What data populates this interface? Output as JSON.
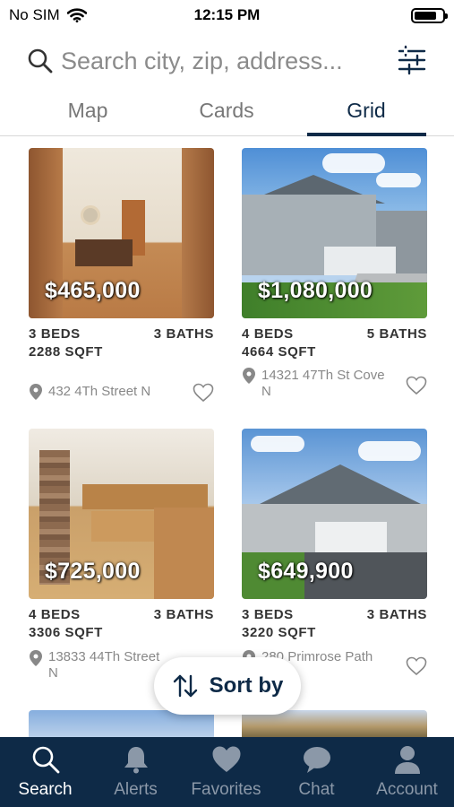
{
  "status_bar": {
    "carrier": "No SIM",
    "time": "12:15 PM"
  },
  "search": {
    "placeholder": "Search city, zip, address..."
  },
  "tabs": [
    {
      "label": "Map",
      "active": false
    },
    {
      "label": "Cards",
      "active": false
    },
    {
      "label": "Grid",
      "active": true
    }
  ],
  "listings": [
    {
      "price": "$465,000",
      "beds": "3 BEDS",
      "baths": "3 BATHS",
      "sqft": "2288 SQFT",
      "address_line1": "432 4Th Street N",
      "address_line2": ""
    },
    {
      "price": "$1,080,000",
      "beds": "4 BEDS",
      "baths": "5 BATHS",
      "sqft": "4664 SQFT",
      "address_line1": "14321 47Th St Cove",
      "address_line2": "N"
    },
    {
      "price": "$725,000",
      "beds": "4 BEDS",
      "baths": "3 BATHS",
      "sqft": "3306 SQFT",
      "address_line1": "13833 44Th Street",
      "address_line2": "N"
    },
    {
      "price": "$649,900",
      "beds": "3 BEDS",
      "baths": "3 BATHS",
      "sqft": "3220 SQFT",
      "address_line1": "280 Primrose Path",
      "address_line2": ""
    }
  ],
  "sort_button": {
    "label": "Sort by"
  },
  "bottom_nav": [
    {
      "label": "Search",
      "icon": "search-icon",
      "active": true
    },
    {
      "label": "Alerts",
      "icon": "bell-icon",
      "active": false
    },
    {
      "label": "Favorites",
      "icon": "heart-icon",
      "active": false
    },
    {
      "label": "Chat",
      "icon": "chat-icon",
      "active": false
    },
    {
      "label": "Account",
      "icon": "person-icon",
      "active": false
    }
  ],
  "colors": {
    "brand_navy": "#0e2a47",
    "inactive_nav": "#8b98a8",
    "muted_text": "#888888"
  }
}
